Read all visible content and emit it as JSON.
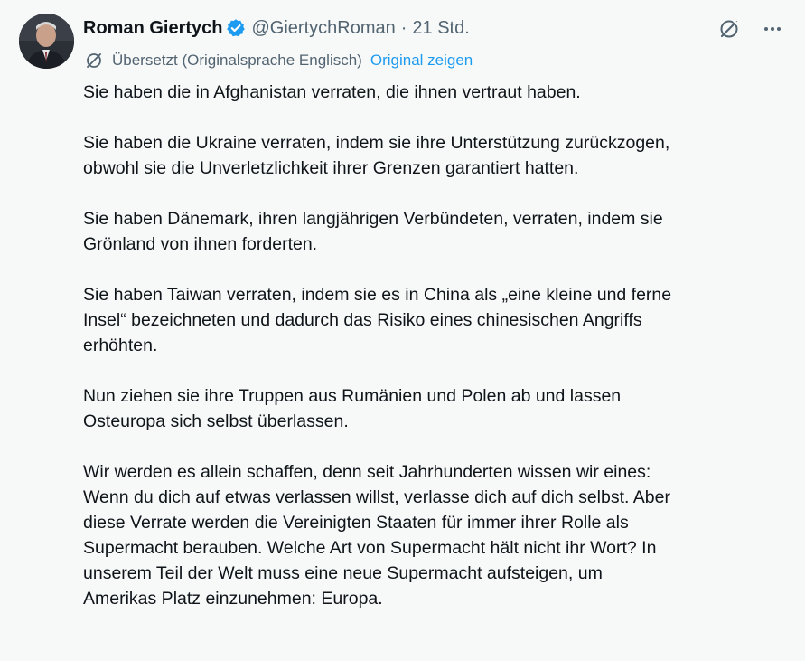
{
  "author": {
    "name": "Roman Giertych",
    "handle": "@GiertychRoman",
    "separator": "·",
    "time": "21 Std.",
    "verified_color": "#1d9bf0"
  },
  "icons": {
    "avatar": "profile-photo",
    "verified": "verified-badge-icon",
    "grok": "grok-icon",
    "more": "more-icon",
    "translate": "translate-icon"
  },
  "translation": {
    "label": "Übersetzt (Originalsprache Englisch)",
    "show_original": "Original zeigen"
  },
  "paragraphs": [
    "Sie haben die in Afghanistan verraten, die ihnen vertraut haben.",
    "Sie haben die Ukraine verraten, indem sie ihre Unterstützung zurückzogen,\nobwohl sie die Unverletzlichkeit ihrer Grenzen garantiert hatten.",
    "Sie haben Dänemark, ihren langjährigen Verbündeten, verraten, indem sie\nGrönland von ihnen forderten.",
    "Sie haben Taiwan verraten, indem sie es in China als „eine kleine und ferne\nInsel“ bezeichneten und dadurch das Risiko eines chinesischen Angriffs\nerhöhten.",
    "Nun ziehen sie ihre Truppen aus Rumänien und Polen ab und lassen\nOsteuropa sich selbst überlassen.",
    "Wir werden es allein schaffen, denn seit Jahrhunderten wissen wir eines:\nWenn du dich auf etwas verlassen willst, verlasse dich auf dich selbst. Aber\ndiese Verrate werden die Vereinigten Staaten für immer ihrer Rolle als\nSupermacht berauben. Welche Art von Supermacht hält nicht ihr Wort? In\nunserem Teil der Welt muss eine neue Supermacht aufsteigen, um\nAmerikas Platz einzunehmen: Europa."
  ],
  "colors": {
    "background": "#f7f9f9",
    "text": "#0f1419",
    "secondary": "#536471",
    "link": "#1d9bf0"
  }
}
